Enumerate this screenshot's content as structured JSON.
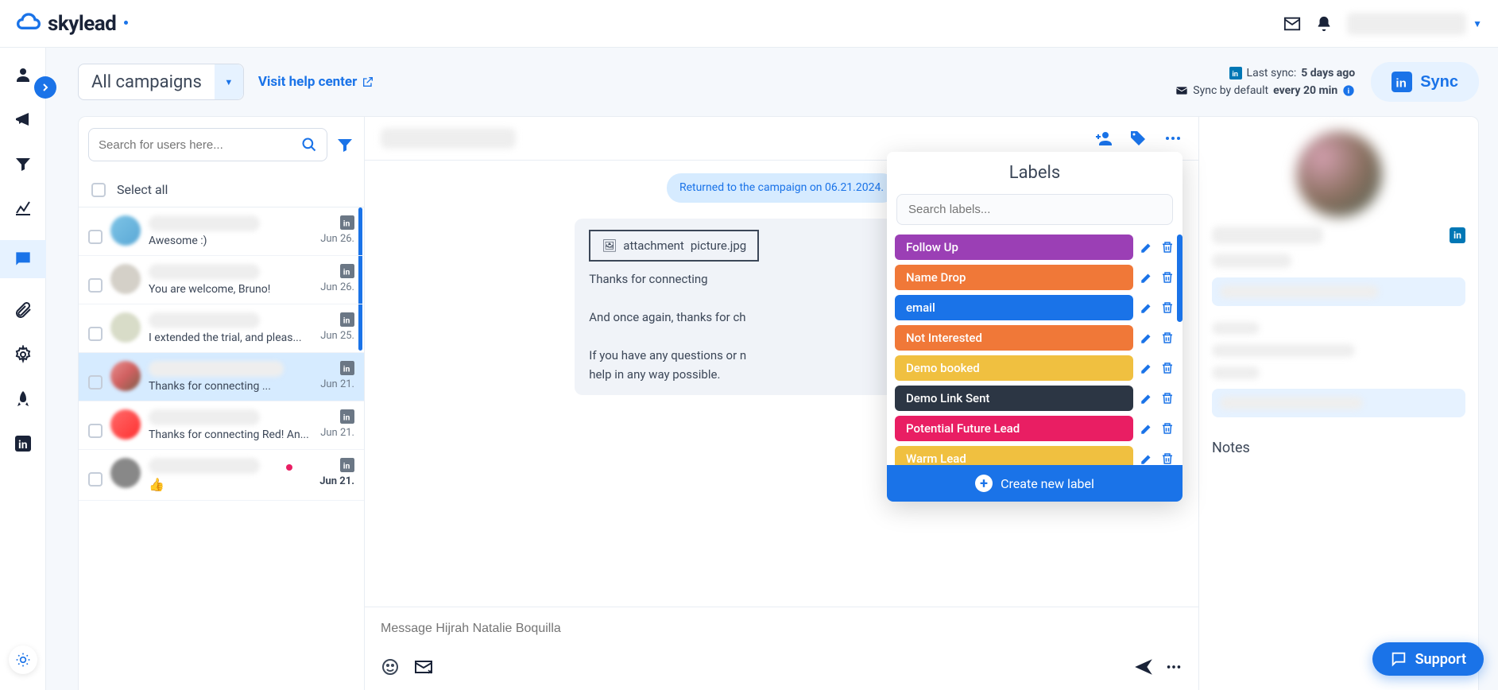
{
  "brand": {
    "name": "skylead"
  },
  "topbar": {},
  "toolbar": {
    "campaign": "All campaigns",
    "help": "Visit help center",
    "last_sync_label": "Last sync:",
    "last_sync_value": "5 days ago",
    "sync_default_label": "Sync by default",
    "sync_default_value": "every 20 min",
    "sync_btn": "Sync"
  },
  "search": {
    "placeholder": "Search for users here..."
  },
  "select_all": "Select all",
  "conversations": [
    {
      "preview": "Awesome :)",
      "date": "Jun 26."
    },
    {
      "preview": "You are welcome, Bruno!",
      "date": "Jun 26."
    },
    {
      "preview": "I extended the trial, and pleas...",
      "date": "Jun 25."
    },
    {
      "preview": "Thanks for connecting           ...",
      "date": "Jun 21."
    },
    {
      "preview": "Thanks for connecting Red! An...",
      "date": "Jun 21."
    },
    {
      "preview_emoji": "👍",
      "date": "Jun 21.",
      "unread": true
    }
  ],
  "chat": {
    "system_msg": "Returned to the campaign                         on 06.21.2024.",
    "attachment_label": "attachment",
    "attachment_name": "picture.jpg",
    "msg_line1": "Thanks for connecting",
    "msg_line2": "And once again, thanks for ch",
    "msg_line3": "If you have any questions or n                                                              contact us through the chat. W                                                       help in any way possible.",
    "input_placeholder": "Message Hijrah Natalie Boquilla"
  },
  "labels_popover": {
    "title": "Labels",
    "search_placeholder": "Search labels...",
    "items": [
      {
        "name": "Follow Up",
        "color": "#9b3fb5"
      },
      {
        "name": "Name Drop",
        "color": "#f07838"
      },
      {
        "name": "email",
        "color": "#1a73e8"
      },
      {
        "name": "Not Interested",
        "color": "#f07838"
      },
      {
        "name": "Demo booked",
        "color": "#f0c040"
      },
      {
        "name": "Demo Link Sent",
        "color": "#2c3644"
      },
      {
        "name": "Potential Future Lead",
        "color": "#e91e63"
      },
      {
        "name": "Warm Lead",
        "color": "#f0c040"
      }
    ],
    "create": "Create new label"
  },
  "details": {
    "notes": "Notes"
  },
  "support": "Support"
}
